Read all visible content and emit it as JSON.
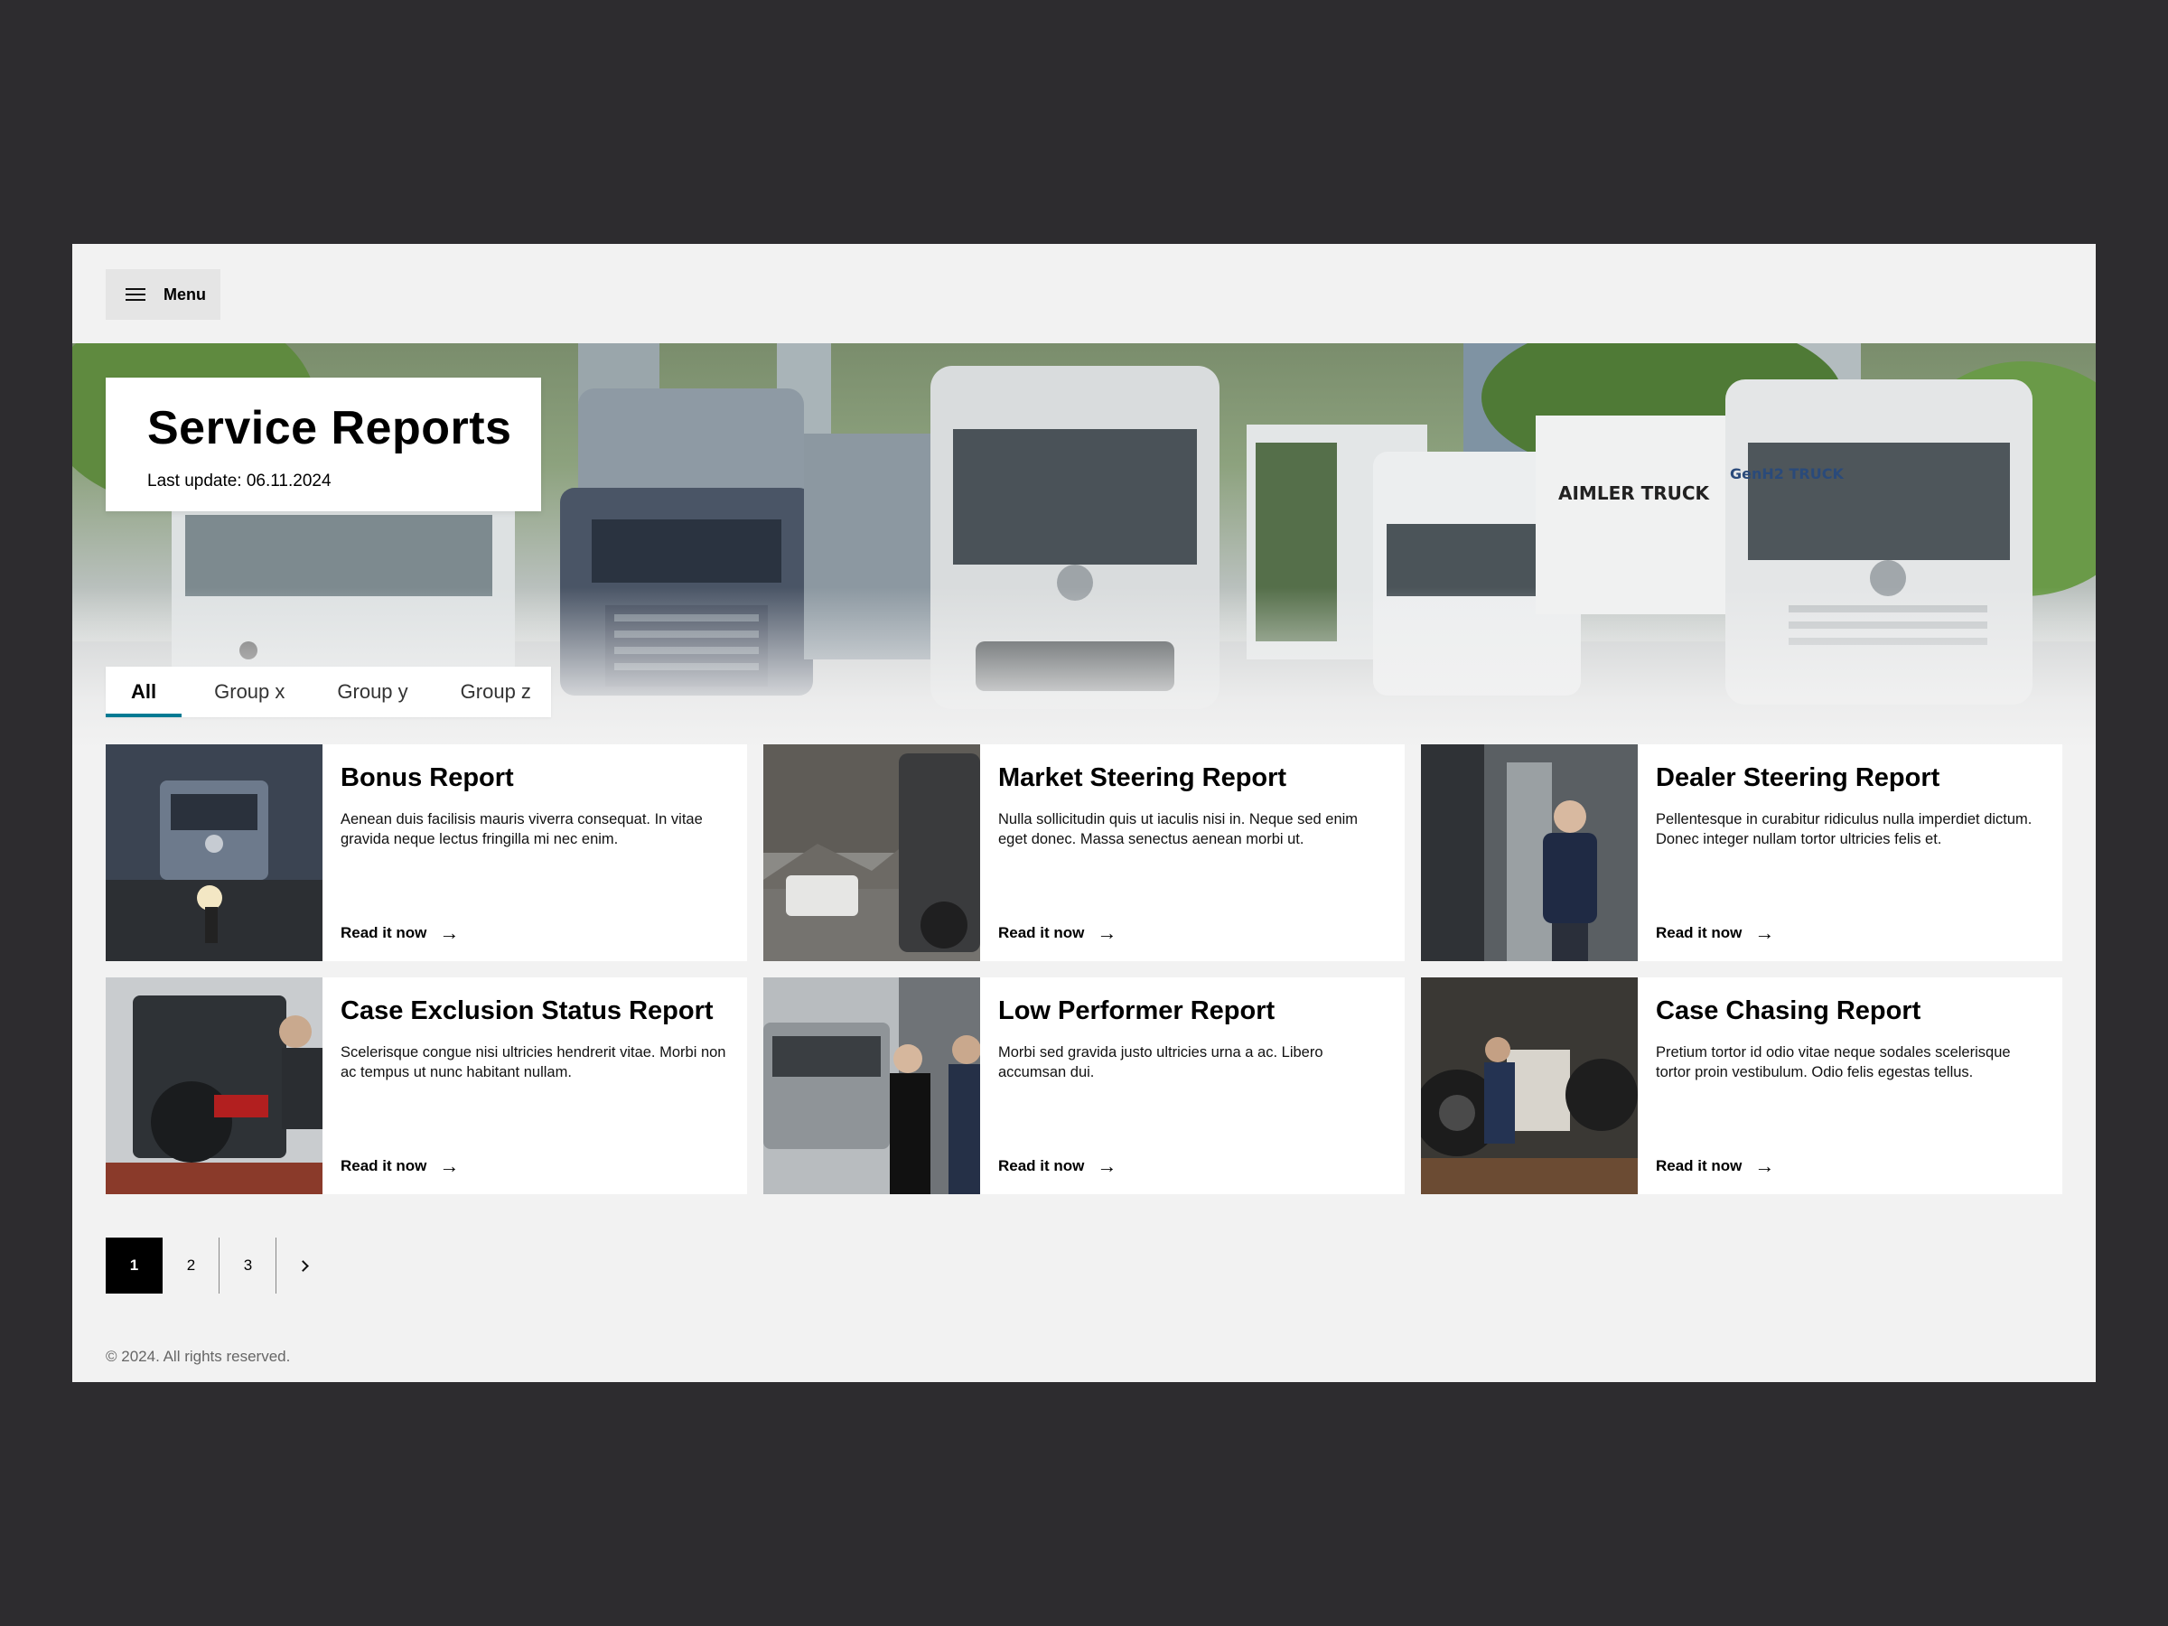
{
  "menu": {
    "label": "Menu"
  },
  "hero": {
    "title": "Service Reports",
    "last_update": "Last update: 06.11.2024",
    "truck_lettering_1": "AIMLER TRUCK",
    "truck_lettering_2": "GenH2 TRUCK"
  },
  "tabs": [
    {
      "label": "All",
      "active": true
    },
    {
      "label": "Group x"
    },
    {
      "label": "Group y"
    },
    {
      "label": "Group z"
    }
  ],
  "cards": [
    {
      "title": "Bonus Report",
      "text": "Aenean duis facilisis mauris viverra consequat. In vitae gravida neque lectus fringilla mi nec enim.",
      "link": "Read it now"
    },
    {
      "title": "Market Steering Report",
      "text": "Nulla sollicitudin quis ut iaculis nisi in. Neque sed enim eget donec. Massa senectus aenean morbi ut.",
      "link": "Read it now"
    },
    {
      "title": "Dealer Steering Report",
      "text": "Pellentesque in curabitur ridiculus nulla imperdiet dictum. Donec integer nullam tortor ultricies felis et.",
      "link": "Read it now"
    },
    {
      "title": "Case Exclusion Status Report",
      "text": "Scelerisque congue nisi ultricies hendrerit vitae. Morbi non ac tempus ut nunc habitant nullam.",
      "link": "Read it now"
    },
    {
      "title": "Low Performer Report",
      "text": "Morbi sed gravida justo ultricies urna a ac. Libero accumsan dui.",
      "link": "Read it now"
    },
    {
      "title": "Case Chasing Report",
      "text": "Pretium tortor id odio vitae neque sodales scelerisque tortor proin vestibulum. Odio felis egestas tellus.",
      "link": "Read it now"
    }
  ],
  "pagination": {
    "pages": [
      "1",
      "2",
      "3"
    ],
    "current": "1"
  },
  "footer": {
    "copyright": "© 2024. All rights reserved."
  },
  "icons": {
    "menu": "hamburger-icon",
    "arrow": "arrow-right-icon",
    "next": "chevron-right-icon"
  },
  "colors": {
    "background": "#2d2c2f",
    "page": "#f2f2f2",
    "tab_accent": "#007a93",
    "active_page": "#000000"
  }
}
